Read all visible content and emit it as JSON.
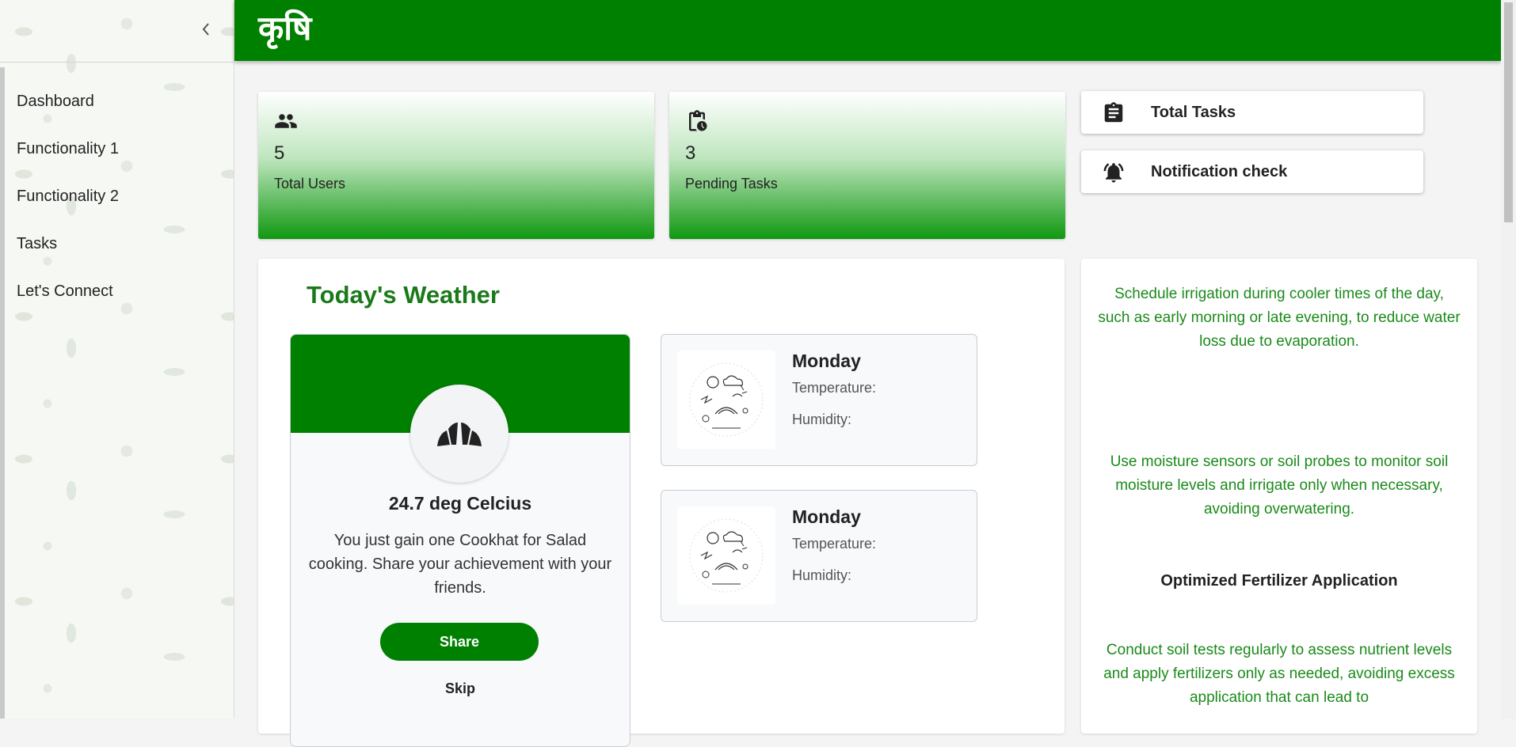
{
  "app": {
    "title": "कृषि"
  },
  "sidebar": {
    "items": [
      {
        "label": "Dashboard"
      },
      {
        "label": "Functionality 1"
      },
      {
        "label": "Functionality 2"
      },
      {
        "label": "Tasks"
      },
      {
        "label": "Let's Connect"
      }
    ]
  },
  "stats": [
    {
      "value": "5",
      "label": "Total Users",
      "icon": "people-icon"
    },
    {
      "value": "3",
      "label": "Pending Tasks",
      "icon": "pending-actions-icon"
    }
  ],
  "side_buttons": [
    {
      "label": "Total Tasks",
      "icon": "clipboard-icon"
    },
    {
      "label": "Notification check",
      "icon": "bell-alert-icon"
    }
  ],
  "weather": {
    "title": "Today's Weather",
    "achievement": {
      "temperature": "24.7 deg Celcius",
      "text": "You just gain one Cookhat for Salad cooking. Share your achievement with your friends.",
      "share_label": "Share",
      "skip_label": "Skip",
      "icon": "croissant-icon"
    },
    "days": [
      {
        "day": "Monday",
        "temperature_label": "Temperature:",
        "humidity_label": "Humidity:"
      },
      {
        "day": "Monday",
        "temperature_label": "Temperature:",
        "humidity_label": "Humidity:"
      }
    ]
  },
  "tips": {
    "tip1": "Schedule irrigation during cooler times of the day, such as early morning or late evening, to reduce water loss due to evaporation.",
    "tip2": "Use moisture sensors or soil probes to monitor soil moisture levels and irrigate only when necessary, avoiding overwatering.",
    "heading": "Optimized Fertilizer Application",
    "tip3": "Conduct soil tests regularly to assess nutrient levels and apply fertilizers only as needed, avoiding excess application that can lead to"
  },
  "colors": {
    "primary": "#008000",
    "tip_text": "#1a8a1a"
  }
}
